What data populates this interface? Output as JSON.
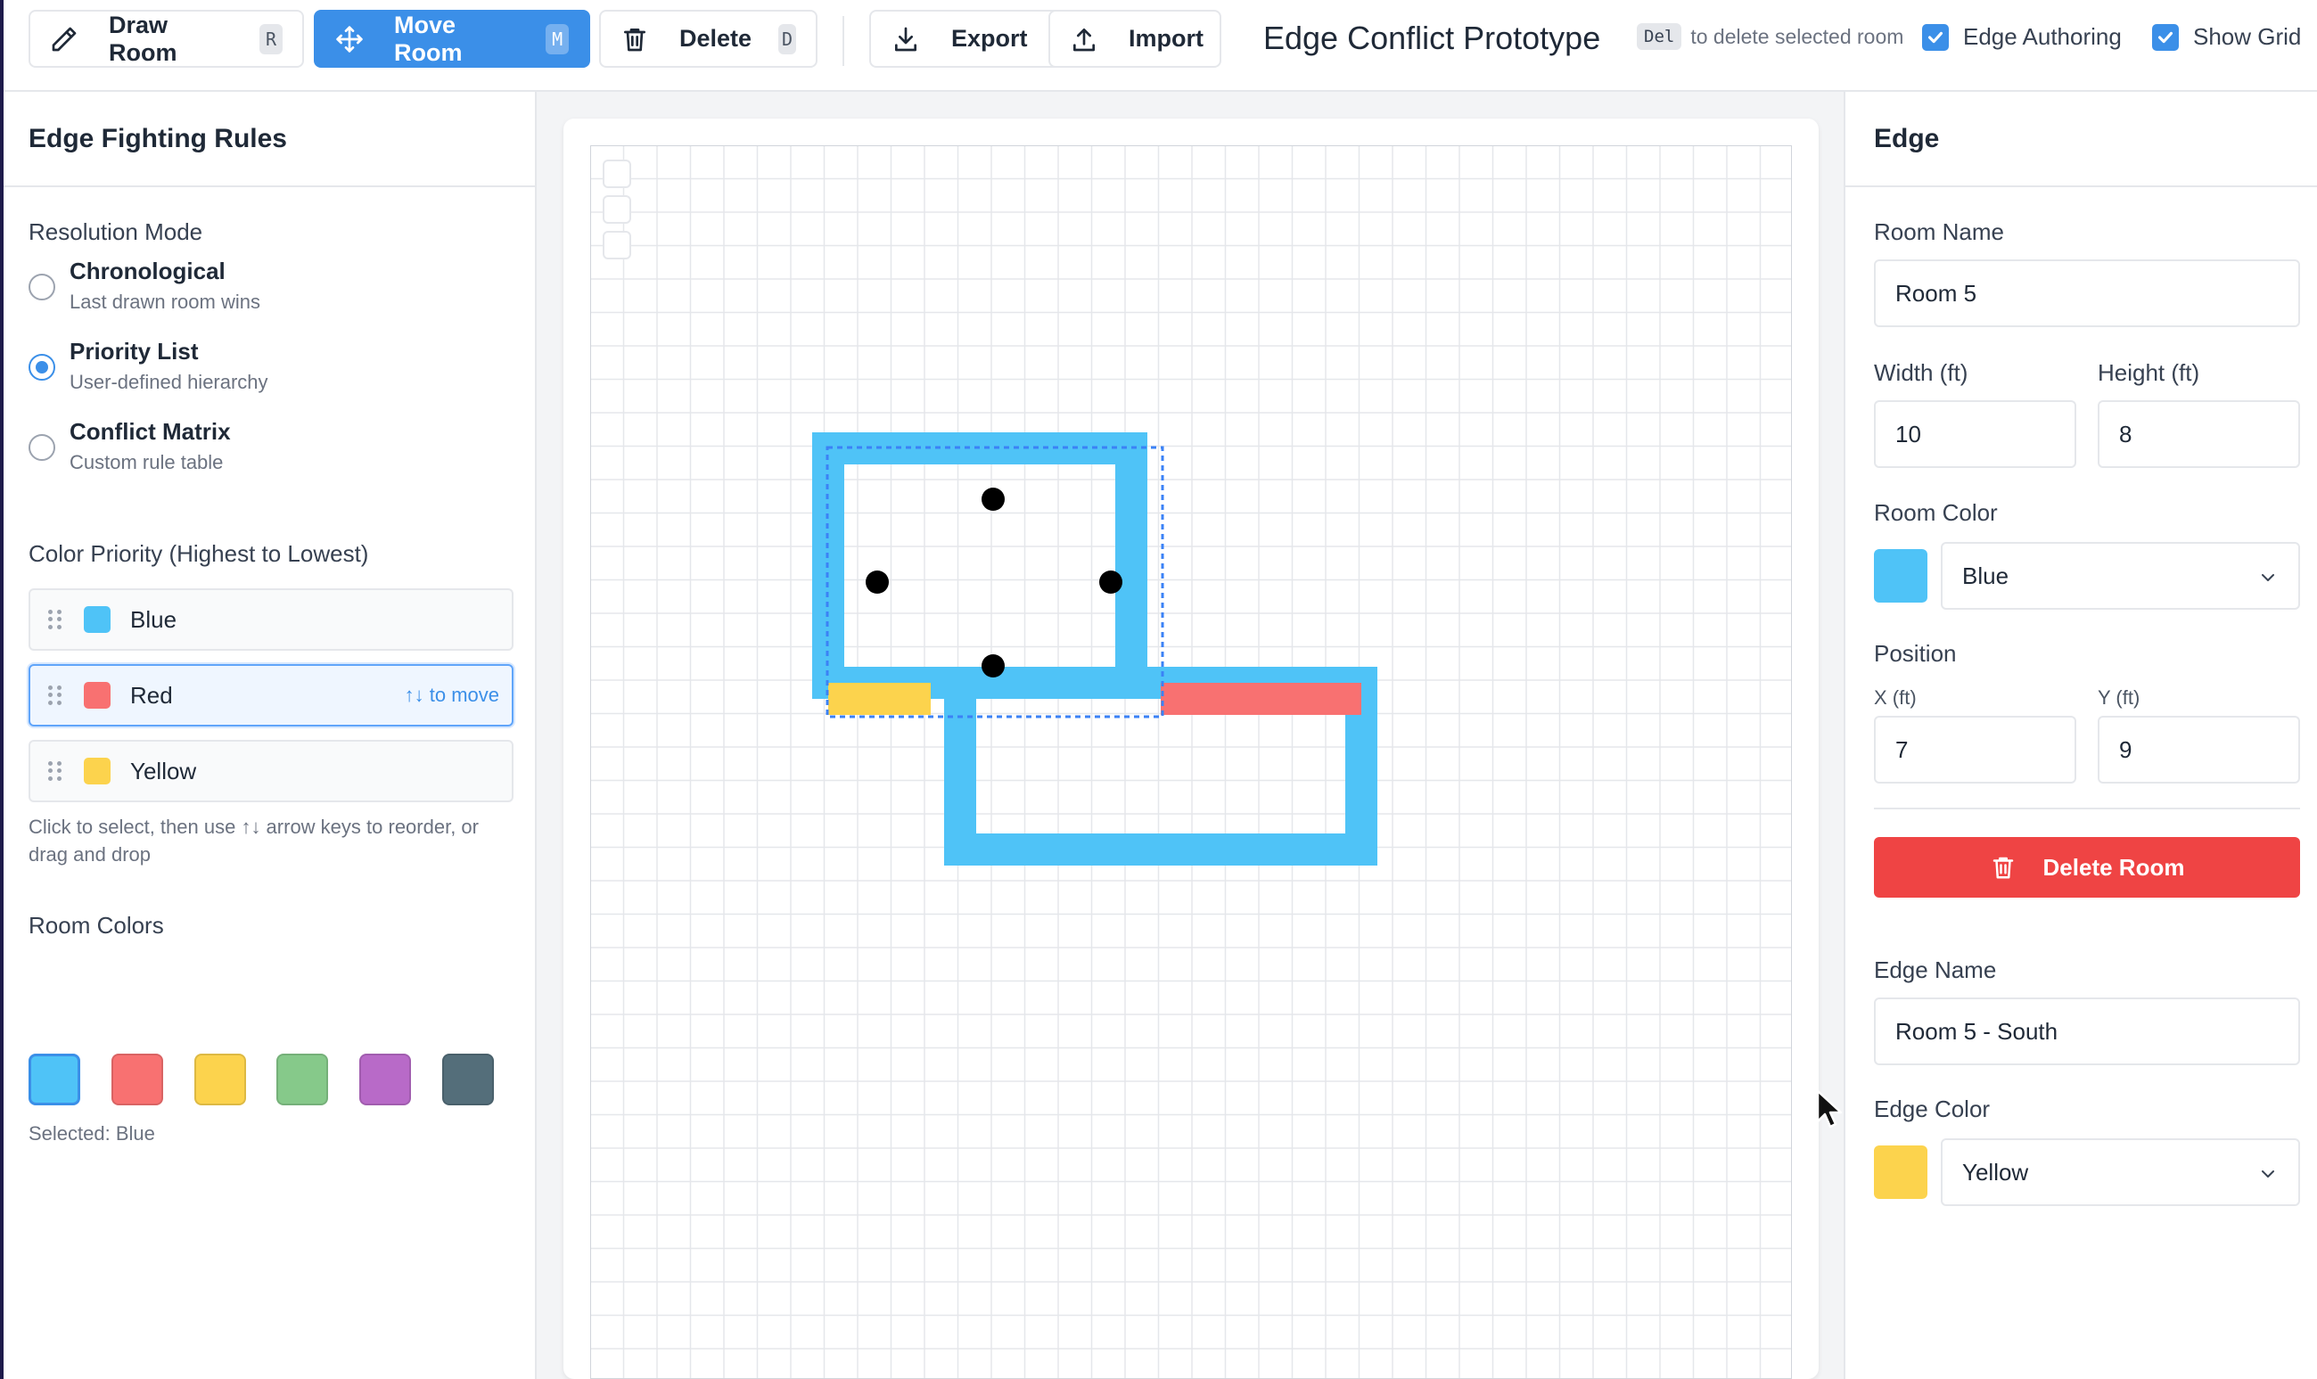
{
  "toolbar": {
    "draw_room": {
      "label": "Draw Room",
      "shortcut": "R"
    },
    "move_room": {
      "label": "Move Room",
      "shortcut": "M"
    },
    "delete": {
      "label": "Delete",
      "shortcut": "D"
    },
    "export_label": "Export",
    "import_label": "Import",
    "app_title": "Edge Conflict Prototype",
    "hint_key": "Del",
    "hint_text": "to delete selected room",
    "edge_authoring": {
      "label": "Edge Authoring",
      "checked": true
    },
    "show_grid": {
      "label": "Show Grid",
      "checked": true
    }
  },
  "left_panel": {
    "title": "Edge Fighting Rules",
    "resolution_title": "Resolution Mode",
    "modes": [
      {
        "label": "Chronological",
        "desc": "Last drawn room wins",
        "checked": false
      },
      {
        "label": "Priority List",
        "desc": "User-defined hierarchy",
        "checked": true
      },
      {
        "label": "Conflict Matrix",
        "desc": "Custom rule table",
        "checked": false
      }
    ],
    "priority_title": "Color Priority (Highest to Lowest)",
    "priority": [
      {
        "name": "Blue",
        "color": "#4fc3f7"
      },
      {
        "name": "Red",
        "color": "#f87171",
        "hint": "↑↓ to move"
      },
      {
        "name": "Yellow",
        "color": "#fcd34d"
      }
    ],
    "help_text": "Click to select, then use ↑↓ arrow keys to reorder, or drag and drop",
    "room_colors_title": "Room Colors",
    "room_colors": [
      "#4fc3f7",
      "#f87171",
      "#fcd34d",
      "#86c98a",
      "#b86ac8",
      "#546e7a"
    ],
    "selected_text": "Selected: Blue"
  },
  "right_panel": {
    "title": "Edge",
    "room_name_label": "Room Name",
    "room_name": "Room 5",
    "width_label": "Width (ft)",
    "width": "10",
    "height_label": "Height (ft)",
    "height": "8",
    "room_color_label": "Room Color",
    "room_color_value": "Blue",
    "room_color_hex": "#4fc3f7",
    "position_label": "Position",
    "x_label": "X (ft)",
    "x": "7",
    "y_label": "Y (ft)",
    "y": "9",
    "delete_room_label": "Delete Room",
    "edge_name_label": "Edge Name",
    "edge_name": "Room 5 - South",
    "edge_color_label": "Edge Color",
    "edge_color_value": "Yellow",
    "edge_color_hex": "#fcd34d"
  },
  "colors": {
    "accent": "#3b8fe8",
    "blue": "#4fc3f7",
    "red": "#f87171",
    "yellow": "#fcd34d",
    "danger": "#ef4444",
    "grid": "#e5e7eb"
  }
}
